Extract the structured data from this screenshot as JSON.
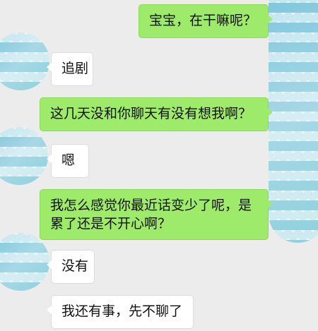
{
  "messages": [
    {
      "side": "me",
      "text": "宝宝，在干嘛呢？"
    },
    {
      "side": "them",
      "text": "追剧"
    },
    {
      "side": "me",
      "text": "这几天没和你聊天有没有想我啊？"
    },
    {
      "side": "them",
      "text": "嗯"
    },
    {
      "side": "me",
      "text": "我怎么感觉你最近话变少了呢，是累了还是不开心啊？"
    },
    {
      "side": "them",
      "text": "没有"
    },
    {
      "side": "them",
      "text": "我还有事，先不聊了"
    }
  ],
  "colors": {
    "sent_bubble": "#9eea6a",
    "received_bubble": "#ffffff",
    "background": "#ececec"
  }
}
